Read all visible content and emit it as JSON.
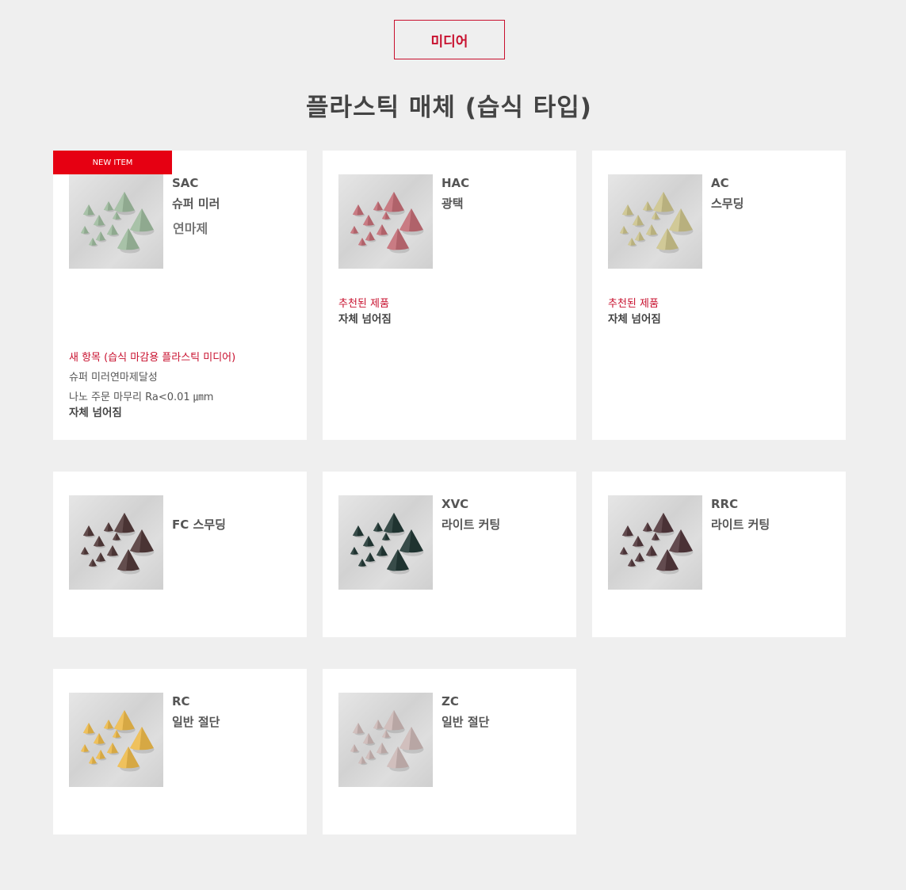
{
  "header": {
    "button_label": "미디어"
  },
  "title": "플라스틱 매체 (습식 타입)",
  "colors": {
    "accent": "#c8102e",
    "badge": "#e60012",
    "background": "#efefef"
  },
  "products": [
    {
      "code": "SAC",
      "subtitle": "슈퍼 미러",
      "subtitle2": "연마제",
      "badge": "NEW ITEM",
      "color": "#8fa98f",
      "notes": {
        "red": "새 항목 (습식 마감용 플라스틱 미디어)",
        "line1": "슈퍼 미러연마제달성",
        "line2": "나노 주문 마무리 Ra<0.01 ㎛m",
        "bold": "자체 넘어짐"
      }
    },
    {
      "code": "HAC",
      "subtitle": "광택",
      "color": "#b0626a",
      "notes": {
        "red": "추천된 제품",
        "bold": "자체 넘어짐"
      }
    },
    {
      "code": "AC",
      "subtitle": "스무딩",
      "color": "#b8b07e",
      "notes": {
        "red": "추천된 제품",
        "bold": "자체 넘어짐"
      }
    },
    {
      "code": "",
      "subtitle": "FC 스무딩",
      "color": "#4a3434"
    },
    {
      "code": "XVC",
      "subtitle": "라이트 커팅",
      "color": "#1f3330"
    },
    {
      "code": "RRC",
      "subtitle": "라이트 커팅",
      "color": "#4a3236"
    },
    {
      "code": "RC",
      "subtitle": "일반 절단",
      "color": "#d6a844"
    },
    {
      "code": "ZC",
      "subtitle": "일반 절단",
      "color": "#b8a6a4"
    }
  ]
}
